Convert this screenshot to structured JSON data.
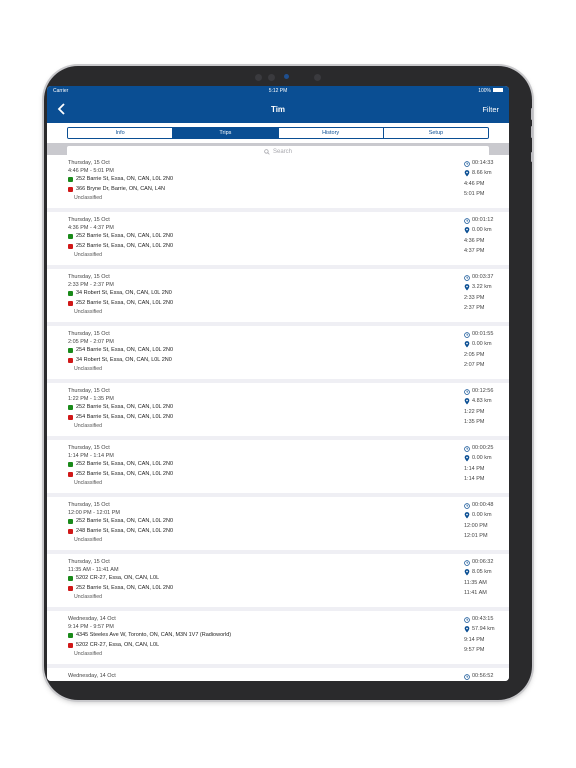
{
  "status_bar": {
    "carrier": "Carrier",
    "time": "5:12 PM",
    "battery": "100%"
  },
  "nav": {
    "title": "Tim",
    "filter_label": "Filter"
  },
  "tabs": [
    {
      "label": "Info",
      "active": false
    },
    {
      "label": "Trips",
      "active": true
    },
    {
      "label": "History",
      "active": false
    },
    {
      "label": "Setup",
      "active": false
    }
  ],
  "search": {
    "placeholder": "Search"
  },
  "colors": {
    "brand": "#0a4e93",
    "start": "#1a8a1a",
    "end": "#d01818"
  },
  "trips": [
    {
      "date": "Thursday, 15 Oct",
      "range": "4:46 PM - 5:01 PM",
      "start": "252 Barrie St, Essa, ON, CAN, L0L 2N0",
      "end": "366 Bryne Dr, Barrie, ON, CAN, L4N",
      "class": "Unclassified",
      "duration": "00:14:33",
      "distance": "8.66 km",
      "start_time": "4:46 PM",
      "end_time": "5:01 PM"
    },
    {
      "date": "Thursday, 15 Oct",
      "range": "4:36 PM - 4:37 PM",
      "start": "252 Barrie St, Essa, ON, CAN, L0L 2N0",
      "end": "252 Barrie St, Essa, ON, CAN, L0L 2N0",
      "class": "Unclassified",
      "duration": "00:01:12",
      "distance": "0.00 km",
      "start_time": "4:36 PM",
      "end_time": "4:37 PM"
    },
    {
      "date": "Thursday, 15 Oct",
      "range": "2:33 PM - 2:37 PM",
      "start": "34 Robert St, Essa, ON, CAN, L0L 2N0",
      "end": "252 Barrie St, Essa, ON, CAN, L0L 2N0",
      "class": "Unclassified",
      "duration": "00:03:37",
      "distance": "3.22 km",
      "start_time": "2:33 PM",
      "end_time": "2:37 PM"
    },
    {
      "date": "Thursday, 15 Oct",
      "range": "2:05 PM - 2:07 PM",
      "start": "254 Barrie St, Essa, ON, CAN, L0L 2N0",
      "end": "34 Robert St, Essa, ON, CAN, L0L 2N0",
      "class": "Unclassified",
      "duration": "00:01:55",
      "distance": "0.00 km",
      "start_time": "2:05 PM",
      "end_time": "2:07 PM"
    },
    {
      "date": "Thursday, 15 Oct",
      "range": "1:22 PM - 1:35 PM",
      "start": "252 Barrie St, Essa, ON, CAN, L0L 2N0",
      "end": "254 Barrie St, Essa, ON, CAN, L0L 2N0",
      "class": "Unclassified",
      "duration": "00:12:56",
      "distance": "4.83 km",
      "start_time": "1:22 PM",
      "end_time": "1:35 PM"
    },
    {
      "date": "Thursday, 15 Oct",
      "range": "1:14 PM - 1:14 PM",
      "start": "252 Barrie St, Essa, ON, CAN, L0L 2N0",
      "end": "252 Barrie St, Essa, ON, CAN, L0L 2N0",
      "class": "Unclassified",
      "duration": "00:00:25",
      "distance": "0.00 km",
      "start_time": "1:14 PM",
      "end_time": "1:14 PM"
    },
    {
      "date": "Thursday, 15 Oct",
      "range": "12:00 PM - 12:01 PM",
      "start": "252 Barrie St, Essa, ON, CAN, L0L 2N0",
      "end": "248 Barrie St, Essa, ON, CAN, L0L 2N0",
      "class": "Unclassified",
      "duration": "00:00:48",
      "distance": "0.00 km",
      "start_time": "12:00 PM",
      "end_time": "12:01 PM"
    },
    {
      "date": "Thursday, 15 Oct",
      "range": "11:35 AM - 11:41 AM",
      "start": "5202 CR-27, Essa, ON, CAN, L0L",
      "end": "252 Barrie St, Essa, ON, CAN, L0L 2N0",
      "class": "Unclassified",
      "duration": "00:06:32",
      "distance": "8.05 km",
      "start_time": "11:35 AM",
      "end_time": "11:41 AM"
    },
    {
      "date": "Wednesday, 14 Oct",
      "range": "9:14 PM - 9:57 PM",
      "start": "4345 Steeles Ave W, Toronto, ON, CAN, M3N 1V7 (Radioworld)",
      "end": "5202 CR-27, Essa, ON, CAN, L0L",
      "class": "Unclassified",
      "duration": "00:43:15",
      "distance": "57.94 km",
      "start_time": "9:14 PM",
      "end_time": "9:57 PM"
    },
    {
      "date": "Wednesday, 14 Oct",
      "range": "",
      "start": "",
      "end": "",
      "class": "",
      "duration": "00:56:52",
      "distance": "",
      "start_time": "",
      "end_time": ""
    }
  ]
}
